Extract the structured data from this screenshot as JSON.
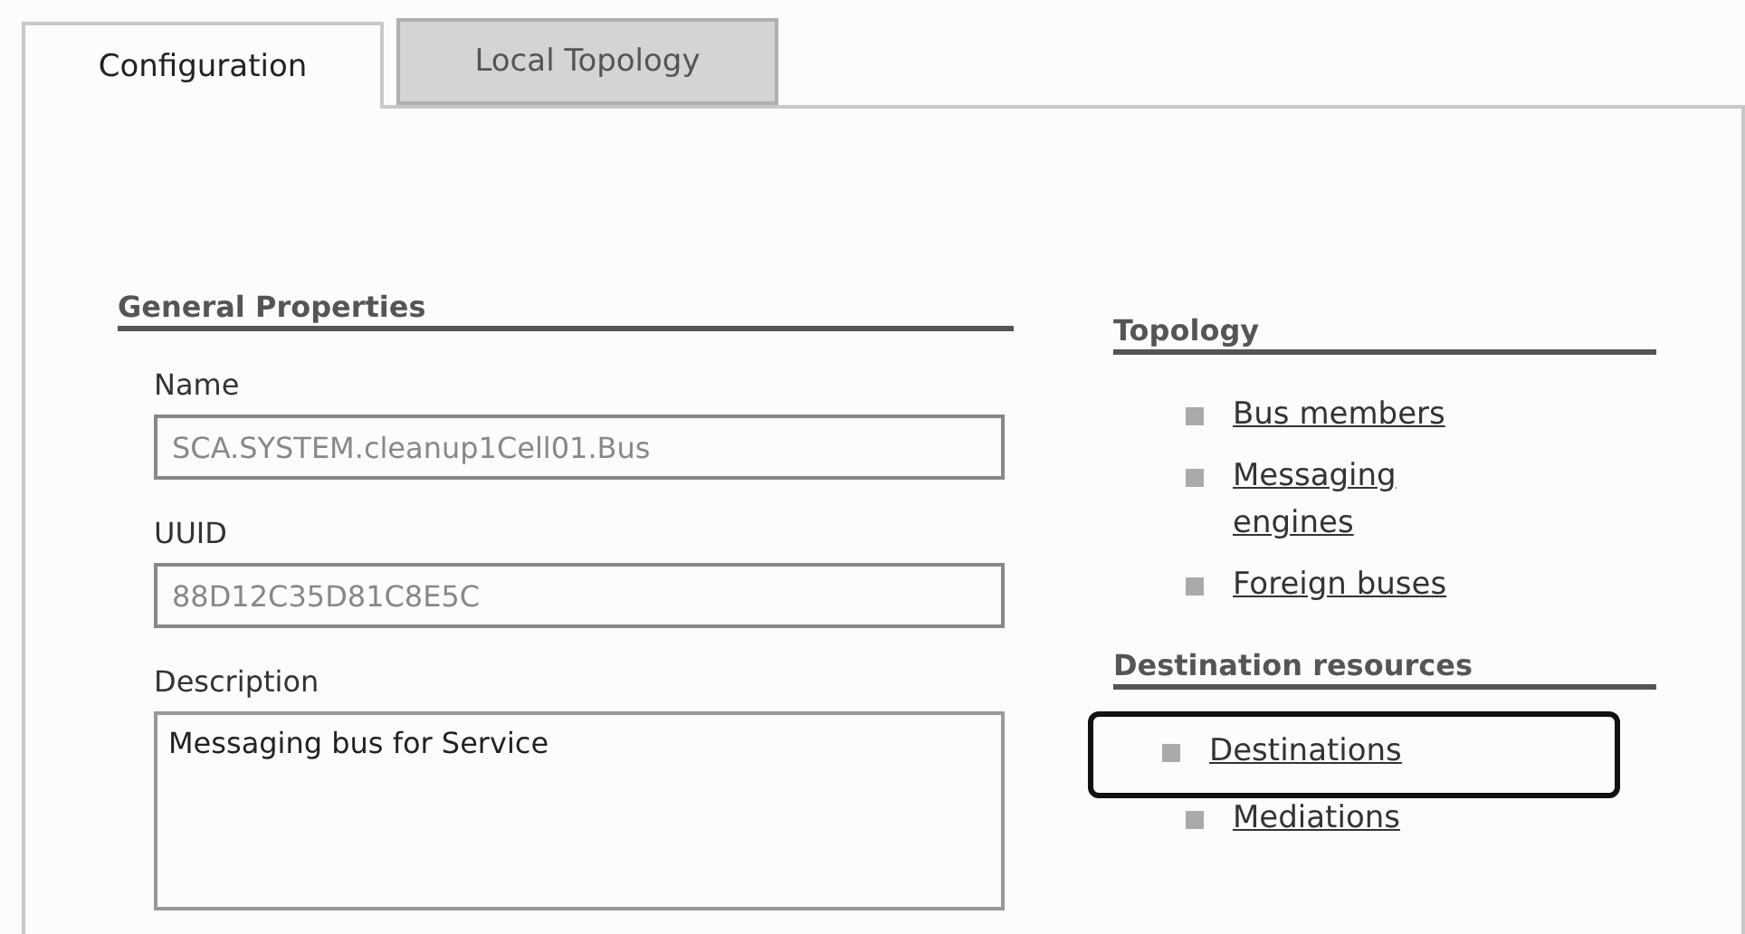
{
  "tabs": [
    {
      "label": "Configuration",
      "selected": true
    },
    {
      "label": "Local Topology",
      "selected": false
    }
  ],
  "general_properties": {
    "title": "General Properties",
    "fields": [
      {
        "label": "Name",
        "kind": "input",
        "value": "SCA.SYSTEM.cleanup1Cell01.Bus",
        "disabled": true
      },
      {
        "label": "UUID",
        "kind": "input",
        "value": "88D12C35D81C8E5C",
        "disabled": true
      },
      {
        "label": "Description",
        "kind": "textarea",
        "value": "Messaging bus for Service",
        "disabled": false
      }
    ]
  },
  "link_groups": [
    {
      "title": "Topology",
      "links": [
        {
          "label": "Bus members",
          "highlighted": false
        },
        {
          "label": "Messaging engines",
          "highlighted": false
        },
        {
          "label": "Foreign buses",
          "highlighted": false
        }
      ]
    },
    {
      "title": "Destination resources",
      "links": [
        {
          "label": "Destinations",
          "highlighted": true
        },
        {
          "label": "Mediations",
          "highlighted": false
        }
      ]
    }
  ]
}
